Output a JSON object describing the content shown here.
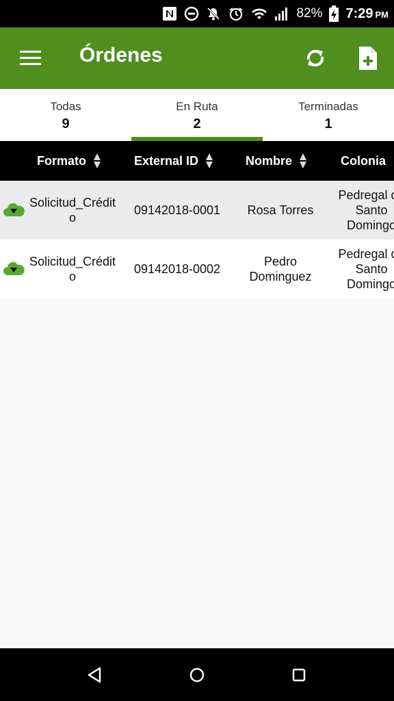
{
  "status_bar": {
    "battery": "82%",
    "time": "7:29",
    "ampm": "PM",
    "icons": [
      "nfc-icon",
      "do-not-disturb-icon",
      "notifications-off-icon",
      "alarm-icon",
      "wifi-icon",
      "signal-icon",
      "battery-charging-icon"
    ]
  },
  "app_bar": {
    "title": "Órdenes",
    "color": "#4f8e1f",
    "icons": [
      "menu-icon",
      "refresh-icon",
      "new-document-icon"
    ]
  },
  "tabs": [
    {
      "label": "Todas",
      "count": "9"
    },
    {
      "label": "En Ruta",
      "count": "2",
      "selected": true
    },
    {
      "label": "Terminadas",
      "count": "1"
    }
  ],
  "table": {
    "columns": [
      "Formato",
      "External ID",
      "Nombre",
      "Colonia"
    ],
    "rows": [
      {
        "formato": "Solicitud_Crédito",
        "external_id": "09142018-0001",
        "nombre": "Rosa Torres",
        "colonia": "Pedregal de Santo Domingo"
      },
      {
        "formato": "Solicitud_Crédito",
        "external_id": "09142018-0002",
        "nombre": "Pedro Dominguez",
        "colonia": "Pedregal de Santo Domingo"
      }
    ]
  },
  "nav_bar": {
    "icons": [
      "back-icon",
      "home-icon",
      "recents-icon"
    ]
  }
}
